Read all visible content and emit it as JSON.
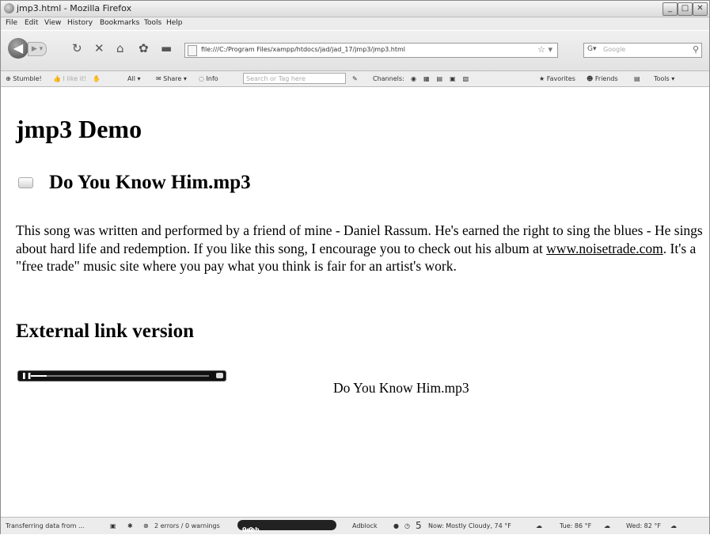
{
  "window": {
    "title": "jmp3.html - Mozilla Firefox"
  },
  "menu": {
    "items": [
      "File",
      "Edit",
      "View",
      "History",
      "Bookmarks",
      "Tools",
      "Help"
    ]
  },
  "nav": {
    "url": "file:///C:/Program Files/xampp/htdocs/jad/jad_17/jmp3/jmp3.html",
    "search_placeholder": "Google"
  },
  "toolbar": {
    "stumble": "Stumble!",
    "like": "I like it!",
    "all": "All ▾",
    "share": "Share ▾",
    "info": "Info",
    "search_placeholder": "Search or Tag here",
    "channels": "Channels:",
    "favorites": "Favorites",
    "friends": "Friends",
    "tools": "Tools ▾"
  },
  "page": {
    "heading": "jmp3 Demo",
    "song_title": "Do You Know Him.mp3",
    "desc_1": "This song was written and performed by a friend of mine - Daniel Rassum. He's earned the right to sing the blues - He sings about hard life and redemption. If you like this song, I encourage you to check out his album at ",
    "desc_link": "www.noisetrade.com",
    "desc_2": ". It's a \"free trade\" music site where you pay what you think is fair for an artist's work.",
    "external_heading": "External link version",
    "player_name": "Do You Know Him.mp3",
    "player_progress": 0.09
  },
  "status": {
    "text": "Transferring data from ...",
    "errors": "2 errors / 0 warnings",
    "veoh": "veoh",
    "veoh_counts": "0 0",
    "adblock": "Adblock",
    "count": "5",
    "now": "Now: Mostly Cloudy, 74 °F",
    "tue": "Tue: 86 °F",
    "wed": "Wed: 82 °F"
  }
}
